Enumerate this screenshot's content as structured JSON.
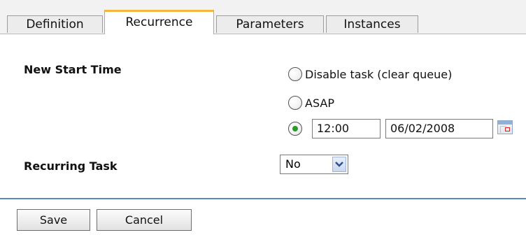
{
  "tabs": [
    {
      "label": "Definition",
      "active": false
    },
    {
      "label": "Recurrence",
      "active": true
    },
    {
      "label": "Parameters",
      "active": false
    },
    {
      "label": "Instances",
      "active": false
    }
  ],
  "form": {
    "new_start_time_label": "New Start Time",
    "options": [
      {
        "label": "Disable task (clear queue)",
        "selected": false
      },
      {
        "label": "ASAP",
        "selected": false
      },
      {
        "label": "",
        "selected": true
      }
    ],
    "time_value": "12:00",
    "date_value": "06/02/2008",
    "recurring_task_label": "Recurring Task",
    "recurring_task_value": "No"
  },
  "buttons": {
    "save_label": "Save",
    "cancel_label": "Cancel"
  },
  "icons": {
    "calendar": "calendar-icon",
    "dropdown": "chevron-down-icon"
  },
  "colors": {
    "active_tab_accent": "#f5b63c",
    "divider": "#5a86c2",
    "radio_checked": "#2a9a2a"
  }
}
